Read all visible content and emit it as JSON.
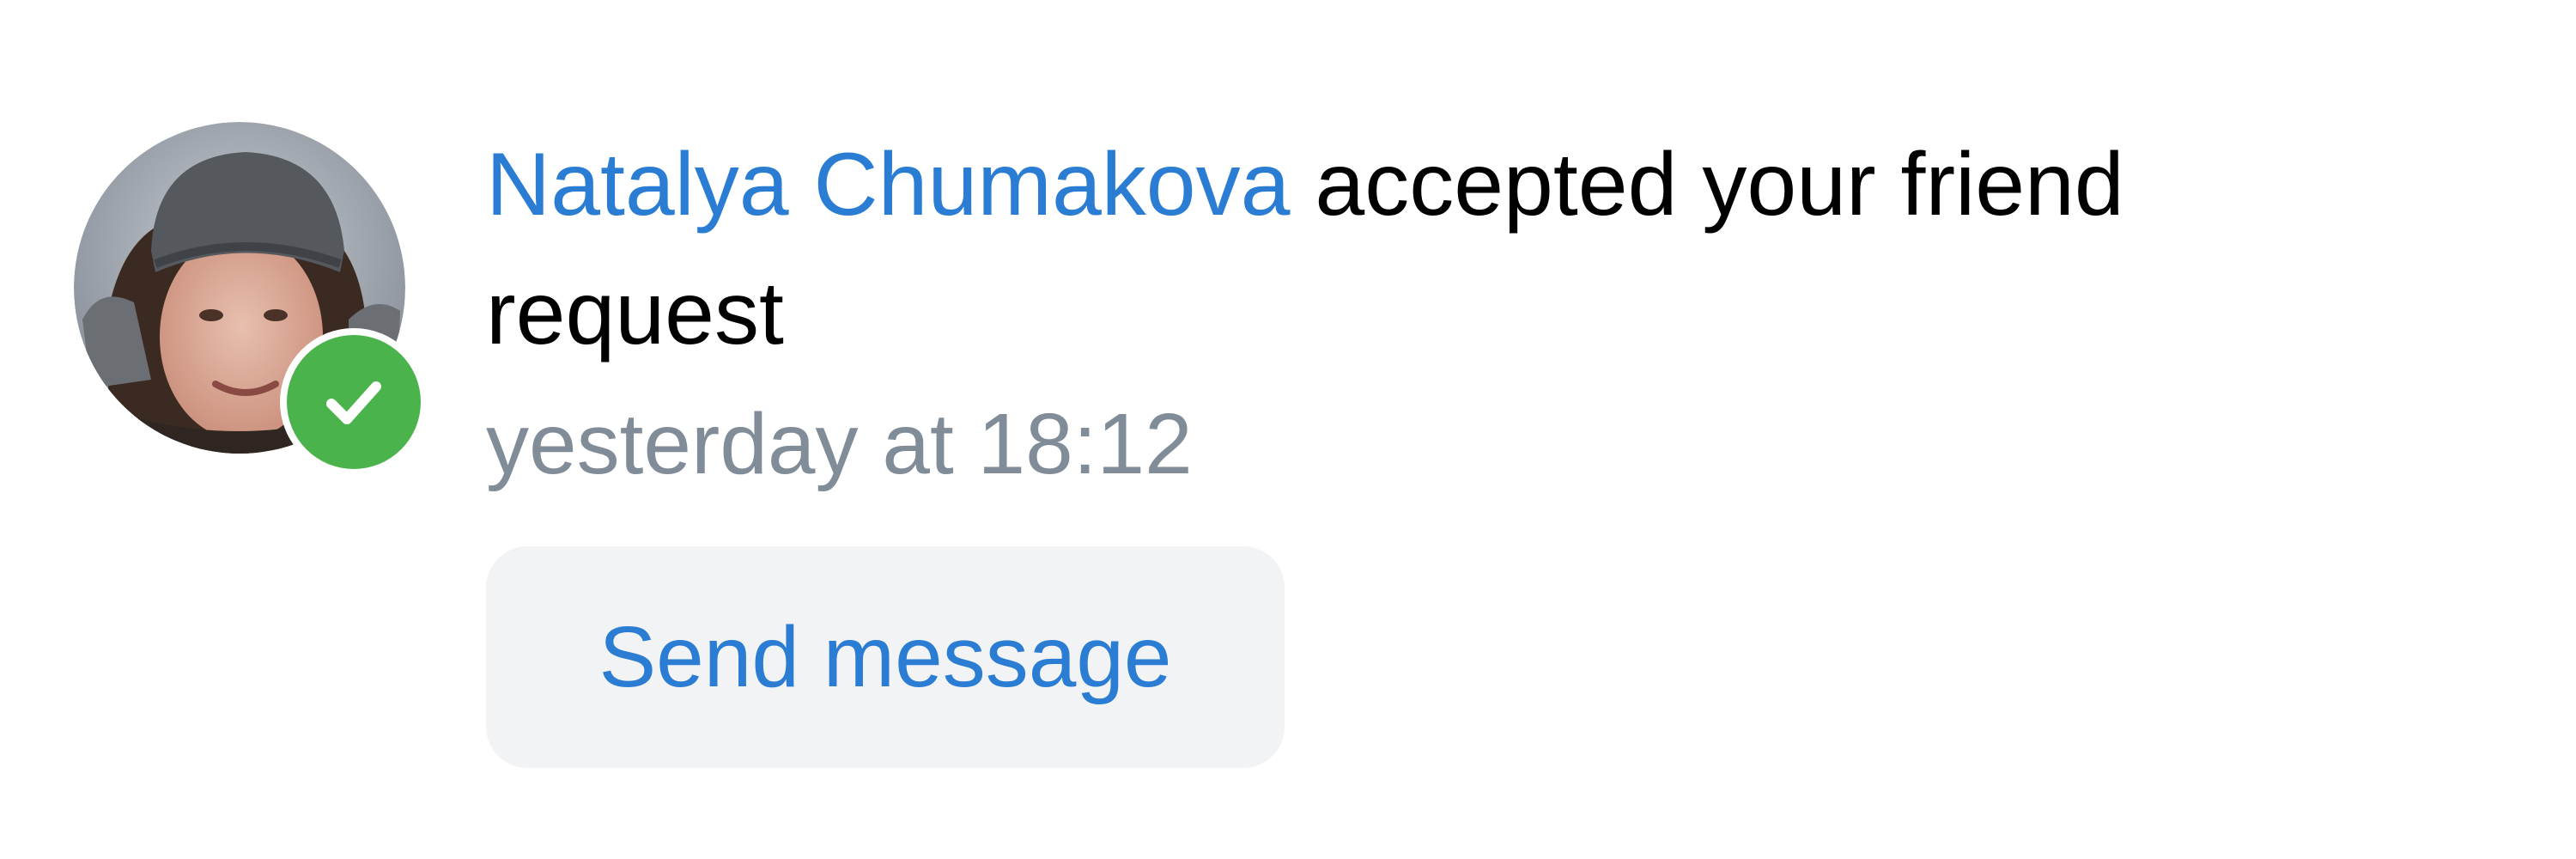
{
  "notification": {
    "user_name": "Natalya Chumakova",
    "message_suffix": " accepted your friend request",
    "timestamp": "yesterday at 18:12",
    "action_label": "Send message",
    "status_icon": "check-icon"
  },
  "colors": {
    "link": "#2a7dd3",
    "text": "#000000",
    "secondary_text": "#818c99",
    "badge_green": "#4bb34b",
    "button_bg": "#f2f3f5"
  }
}
